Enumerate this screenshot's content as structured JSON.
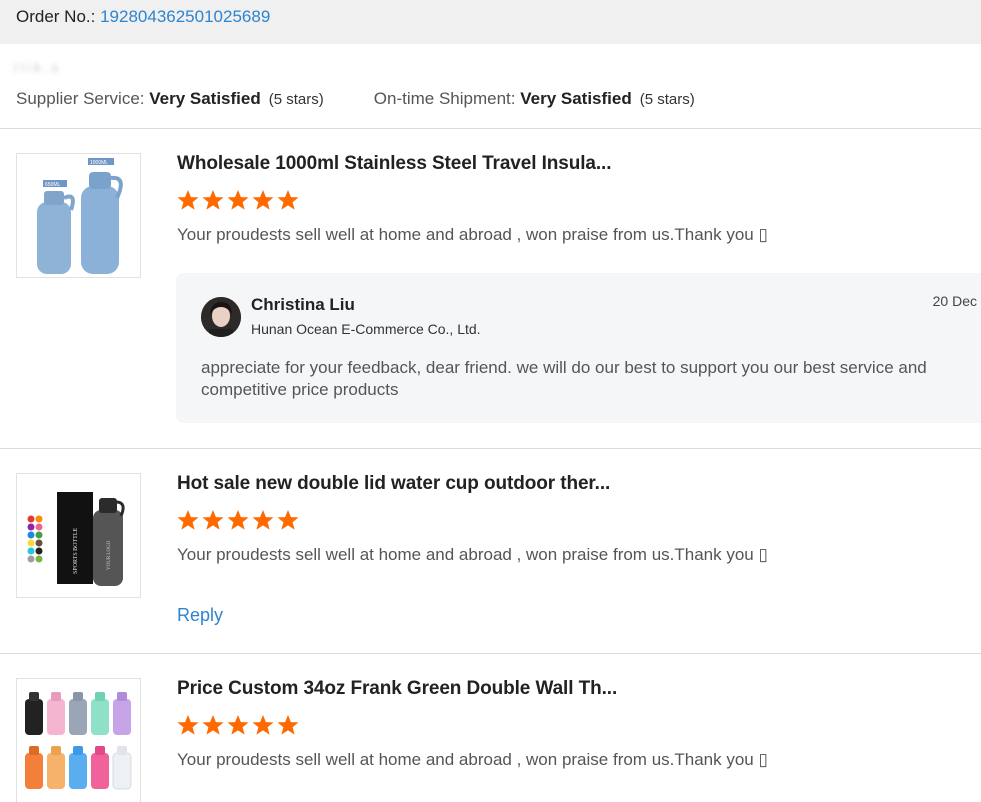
{
  "order": {
    "label": "Order No.: ",
    "number": "192804362501025689"
  },
  "buyer": {
    "name_redacted": "I   l i  k   ,            s"
  },
  "ratings": {
    "supplier_service": {
      "label": "Supplier Service: ",
      "value": "Very Satisfied",
      "stars": "(5 stars)"
    },
    "ontime_shipment": {
      "label": "On-time Shipment: ",
      "value": "Very Satisfied",
      "stars": "(5 stars)"
    }
  },
  "colors": {
    "star": "#ff6a00",
    "link": "#2d84d0",
    "order_bar": "#f0f0f0",
    "reply_bg": "#f5f6f8"
  },
  "reviews": [
    {
      "title": "Wholesale 1000ml Stainless Steel Travel Insula...",
      "rating": 5,
      "comment": "Your proudests sell well at home and abroad , won praise from us.Thank you ▯",
      "thumb_labels": [
        "650ML",
        "1000ML"
      ],
      "reply": {
        "name": "Christina Liu",
        "company": "Hunan Ocean E-Commerce Co., Ltd.",
        "date": "20 Dec",
        "text": "appreciate for your feedback, dear friend. we will do our best to support you our best service and competitive price products"
      }
    },
    {
      "title": "Hot sale new double lid water cup outdoor ther...",
      "rating": 5,
      "comment": "Your proudests sell well at home and abroad , won praise from us.Thank you ▯",
      "reply_link": "Reply",
      "thumb_labels": [
        "SPORTS BOTTLE",
        "YOUR LOGO"
      ]
    },
    {
      "title": "Price Custom 34oz Frank Green Double Wall Th...",
      "rating": 5,
      "comment": "Your proudests sell well at home and abroad , won praise from us.Thank you ▯"
    }
  ]
}
